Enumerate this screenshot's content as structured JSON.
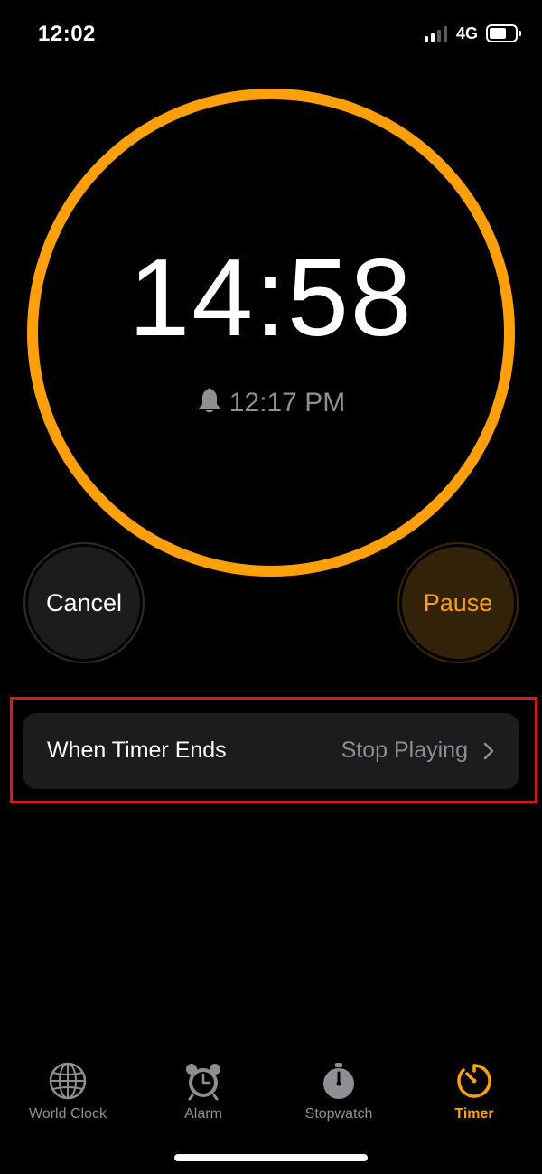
{
  "status_bar": {
    "time": "12:02",
    "network": "4G"
  },
  "timer": {
    "remaining": "14:58",
    "end_time": "12:17 PM",
    "ring_color": "#ff9f0a",
    "progress_fraction": 1.0
  },
  "buttons": {
    "cancel_label": "Cancel",
    "pause_label": "Pause"
  },
  "settings_row": {
    "label": "When Timer Ends",
    "value": "Stop Playing"
  },
  "tab_bar": {
    "tabs": [
      {
        "label": "World Clock",
        "icon": "globe-icon",
        "active": false
      },
      {
        "label": "Alarm",
        "icon": "alarm-clock-icon",
        "active": false
      },
      {
        "label": "Stopwatch",
        "icon": "stopwatch-icon",
        "active": false
      },
      {
        "label": "Timer",
        "icon": "timer-icon",
        "active": true
      }
    ]
  },
  "colors": {
    "accent": "#ff9f0a",
    "highlight": "#e0141e",
    "secondary_text": "#8e8e93",
    "row_background": "#1c1c1e"
  }
}
